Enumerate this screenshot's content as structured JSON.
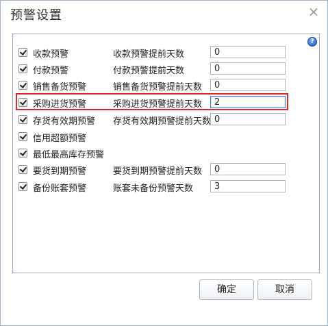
{
  "dialog": {
    "title": "预警设置",
    "close_symbol": "×",
    "help_symbol": "?"
  },
  "rows": [
    {
      "checked": true,
      "label": "收款预警",
      "days_label": "收款预警提前天数",
      "days_value": "0"
    },
    {
      "checked": true,
      "label": "付款预警",
      "days_label": "付款预警提前天数",
      "days_value": "0"
    },
    {
      "checked": true,
      "label": "销售备货预警",
      "days_label": "销售备货预警提前天数",
      "days_value": "0"
    },
    {
      "checked": true,
      "label": "采购进货预警",
      "days_label": "采购进货预警提前天数",
      "days_value": "2"
    },
    {
      "checked": true,
      "label": "存货有效期预警",
      "days_label": "存货有效期预警提前天数",
      "days_value": "0"
    },
    {
      "checked": true,
      "label": "信用超额预警"
    },
    {
      "checked": true,
      "label": "最低最高库存预警"
    },
    {
      "checked": true,
      "label": "要货到期预警",
      "days_label": "要货到期预警提前天数",
      "days_value": "0"
    },
    {
      "checked": true,
      "label": "备份账套预警",
      "days_label": "账套未备份预警天数",
      "days_value": "3"
    }
  ],
  "buttons": {
    "ok": "确定",
    "cancel": "取消"
  },
  "colors": {
    "highlight": "#e0262c",
    "border": "#9aa8b8"
  }
}
